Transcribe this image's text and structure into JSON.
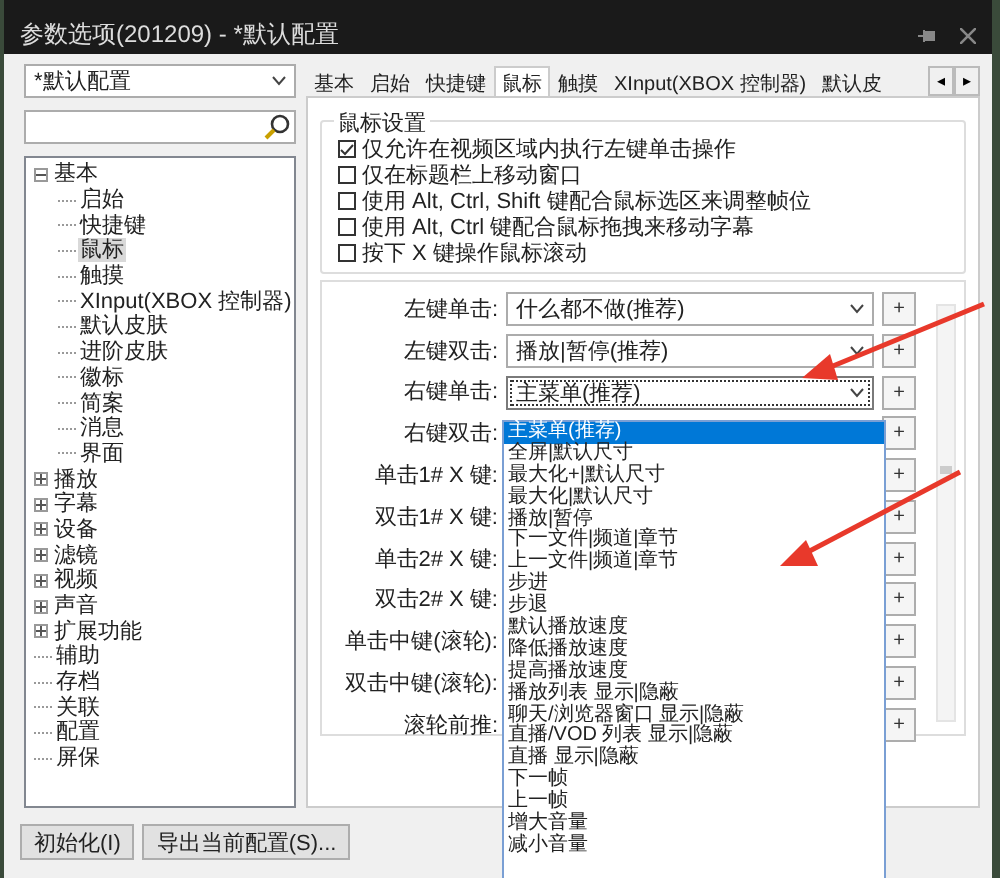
{
  "window": {
    "title": "参数选项(201209) - *默认配置"
  },
  "profile": {
    "value": "*默认配置"
  },
  "tree": [
    {
      "label": "基本",
      "expanded": true,
      "selected": false,
      "children": [
        {
          "label": "启始",
          "selected": false
        },
        {
          "label": "快捷键",
          "selected": false
        },
        {
          "label": "鼠标",
          "selected": true
        },
        {
          "label": "触摸",
          "selected": false
        },
        {
          "label": "XInput(XBOX 控制器)",
          "selected": false
        },
        {
          "label": "默认皮肤",
          "selected": false
        },
        {
          "label": "进阶皮肤",
          "selected": false
        },
        {
          "label": "徽标",
          "selected": false
        },
        {
          "label": "简案",
          "selected": false
        },
        {
          "label": "消息",
          "selected": false
        },
        {
          "label": "界面",
          "selected": false
        }
      ]
    },
    {
      "label": "播放",
      "expanded": false,
      "selected": false
    },
    {
      "label": "字幕",
      "expanded": false,
      "selected": false
    },
    {
      "label": "设备",
      "expanded": false,
      "selected": false
    },
    {
      "label": "滤镜",
      "expanded": false,
      "selected": false
    },
    {
      "label": "视频",
      "expanded": false,
      "selected": false
    },
    {
      "label": "声音",
      "expanded": false,
      "selected": false
    },
    {
      "label": "扩展功能",
      "expanded": false,
      "selected": false
    },
    {
      "label": "辅助",
      "selected": false
    },
    {
      "label": "存档",
      "selected": false
    },
    {
      "label": "关联",
      "selected": false
    },
    {
      "label": "配置",
      "selected": false
    },
    {
      "label": "屏保",
      "selected": false
    }
  ],
  "buttons": [
    "初始化(I)",
    "导出当前配置(S)..."
  ],
  "tabs": [
    {
      "label": "基本",
      "selected": false
    },
    {
      "label": "启始",
      "selected": false
    },
    {
      "label": "快捷键",
      "selected": false
    },
    {
      "label": "鼠标",
      "selected": true
    },
    {
      "label": "触摸",
      "selected": false
    },
    {
      "label": "XInput(XBOX 控制器)",
      "selected": false
    },
    {
      "label": "默认皮",
      "selected": false
    }
  ],
  "tab_scroll": [
    "◂",
    "▸"
  ],
  "group": {
    "title": "鼠标设置",
    "options": [
      {
        "label": "仅允许在视频区域内执行左键单击操作",
        "checked": true
      },
      {
        "label": "仅在标题栏上移动窗口",
        "checked": false
      },
      {
        "label": "使用 Alt, Ctrl, Shift 键配合鼠标选区来调整帧位",
        "checked": false
      },
      {
        "label": "使用 Alt, Ctrl 键配合鼠标拖拽来移动字幕",
        "checked": false
      },
      {
        "label": "按下 X 键操作鼠标滚动",
        "checked": false
      }
    ]
  },
  "bindings": [
    {
      "label": "左键单击:",
      "value": "什么都不做(推荐)",
      "focused": false,
      "add": "+"
    },
    {
      "label": "左键双击:",
      "value": "播放|暂停(推荐)",
      "focused": false,
      "add": "+"
    },
    {
      "label": "右键单击:",
      "value": "主菜单(推荐)",
      "focused": true,
      "add": "+"
    },
    {
      "label": "右键双击:",
      "add": "+"
    },
    {
      "label": "单击1# X 键:",
      "add": "+"
    },
    {
      "label": "双击1# X 键:",
      "add": "+"
    },
    {
      "label": "单击2# X 键:",
      "add": "+"
    },
    {
      "label": "双击2# X 键:",
      "add": "+"
    },
    {
      "label": "单击中键(滚轮):",
      "add": "+"
    },
    {
      "label": "双击中键(滚轮):",
      "add": "+"
    },
    {
      "label": "滚轮前推:",
      "add": "+"
    }
  ],
  "dropdown": {
    "items": [
      {
        "label": "主菜单(推荐)",
        "selected": true
      },
      {
        "label": "全屏|默认尺寸",
        "selected": false
      },
      {
        "label": "最大化+|默认尺寸",
        "selected": false
      },
      {
        "label": "最大化|默认尺寸",
        "selected": false
      },
      {
        "label": "播放|暂停",
        "selected": false
      },
      {
        "label": "下一文件|频道|章节",
        "selected": false
      },
      {
        "label": "上一文件|频道|章节",
        "selected": false
      },
      {
        "label": "步进",
        "selected": false
      },
      {
        "label": "步退",
        "selected": false
      },
      {
        "label": "默认播放速度",
        "selected": false
      },
      {
        "label": "降低播放速度",
        "selected": false
      },
      {
        "label": "提高播放速度",
        "selected": false
      },
      {
        "label": "播放列表 显示|隐蔽",
        "selected": false
      },
      {
        "label": "聊天/浏览器窗口 显示|隐蔽",
        "selected": false
      },
      {
        "label": "直播/VOD 列表 显示|隐蔽",
        "selected": false
      },
      {
        "label": "直播 显示|隐蔽",
        "selected": false
      },
      {
        "label": "下一帧",
        "selected": false
      },
      {
        "label": "上一帧",
        "selected": false
      },
      {
        "label": "增大音量",
        "selected": false
      },
      {
        "label": "减小音量",
        "selected": false
      }
    ]
  },
  "annotations": [
    {
      "kind": "arrow"
    },
    {
      "kind": "arrow"
    }
  ]
}
